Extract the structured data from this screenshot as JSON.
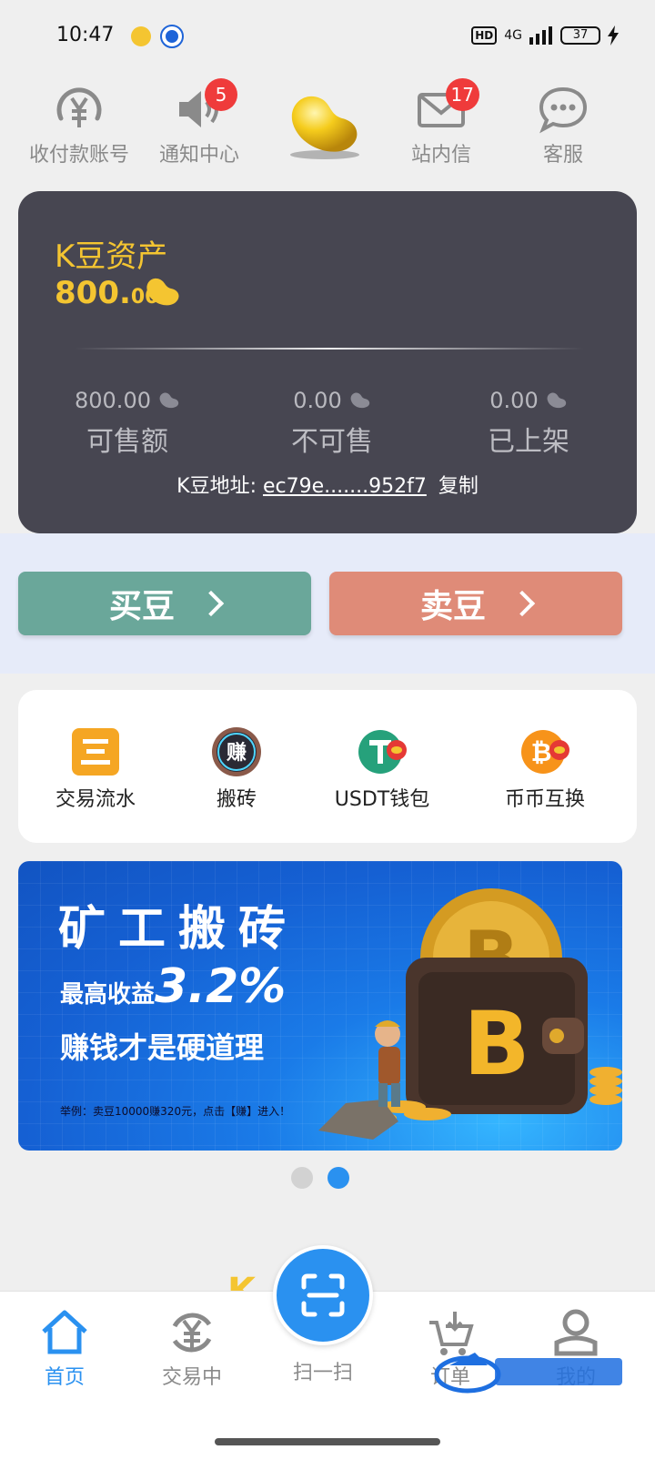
{
  "status_bar": {
    "time": "10:47",
    "hd": "HD",
    "network": "4G",
    "battery": "37"
  },
  "top_nav": {
    "items": [
      {
        "label": "收付款账号"
      },
      {
        "label": "通知中心",
        "badge": "5"
      },
      {
        "label": "站内信",
        "badge": "17"
      },
      {
        "label": "客服"
      }
    ]
  },
  "asset": {
    "title": "K豆资产",
    "amount_int": "800.",
    "amount_dec": "00",
    "stats": [
      {
        "value": "800.00",
        "label": "可售额"
      },
      {
        "value": "0.00",
        "label": "不可售"
      },
      {
        "value": "0.00",
        "label": "已上架"
      }
    ],
    "address_label": "K豆地址:",
    "address": "ec79e.......952f7",
    "copy_label": "复制"
  },
  "trade": {
    "buy_label": "买豆",
    "sell_label": "卖豆"
  },
  "features": [
    {
      "label": "交易流水"
    },
    {
      "label": "搬砖"
    },
    {
      "label": "USDT钱包"
    },
    {
      "label": "币币互换"
    }
  ],
  "banner": {
    "title": "矿工搬砖",
    "sub_small": "最高收益",
    "sub_big": "3.2%",
    "slogan": "赚钱才是硬道理",
    "note": "举例：卖豆10000赚320元，点击【赚】进入！",
    "icon_badge": "赚"
  },
  "pager": {
    "count": 2,
    "active": 2
  },
  "bottom_nav": {
    "tabs": [
      {
        "label": "首页"
      },
      {
        "label": "交易中"
      },
      {
        "label": "扫一扫"
      },
      {
        "label": "订单"
      },
      {
        "label": "我的"
      }
    ]
  },
  "colors": {
    "accent": "#2a91f0",
    "gold": "#f4c531",
    "card": "#474651",
    "buy": "#6aa79a",
    "sell": "#df8b78",
    "badge": "#ef3b3b"
  }
}
